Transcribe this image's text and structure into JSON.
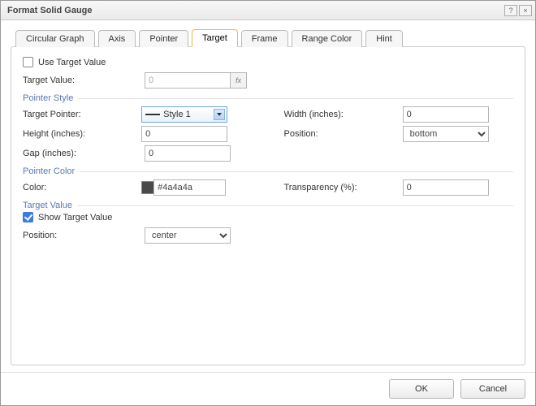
{
  "title": "Format Solid Gauge",
  "tabs": [
    "Circular Graph",
    "Axis",
    "Pointer",
    "Target",
    "Frame",
    "Range Color",
    "Hint"
  ],
  "activeTab": 3,
  "useTarget": {
    "label": "Use Target Value",
    "checked": false
  },
  "targetValue": {
    "label": "Target Value:",
    "value": "0",
    "fx": "fx"
  },
  "group_pointerStyle": "Pointer Style",
  "targetPointer": {
    "label": "Target Pointer:",
    "value": "Style 1"
  },
  "width": {
    "label": "Width (inches):",
    "value": "0"
  },
  "height": {
    "label": "Height (inches):",
    "value": "0"
  },
  "position1": {
    "label": "Position:",
    "value": "bottom"
  },
  "gap": {
    "label": "Gap (inches):",
    "value": "0"
  },
  "group_pointerColor": "Pointer Color",
  "color": {
    "label": "Color:",
    "value": "#4a4a4a",
    "swatch": "#4a4a4a"
  },
  "transparency": {
    "label": "Transparency (%):",
    "value": "0"
  },
  "group_targetValue": "Target Value",
  "showTargetValue": {
    "label": "Show Target Value",
    "checked": true
  },
  "position2": {
    "label": "Position:",
    "value": "center"
  },
  "buttons": {
    "ok": "OK",
    "cancel": "Cancel"
  }
}
